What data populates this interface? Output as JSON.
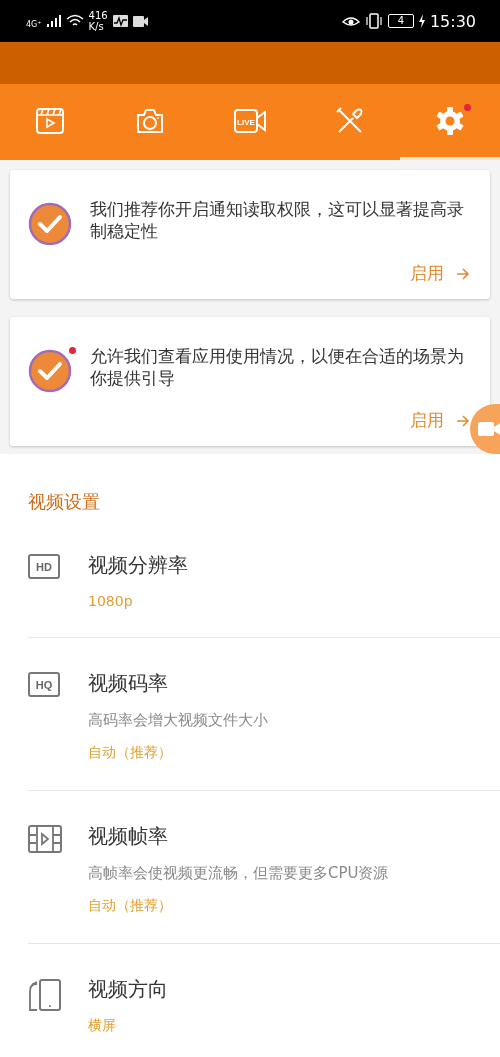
{
  "status_bar": {
    "network": "4G⁺",
    "speed_value": "416",
    "speed_unit": "K/s",
    "battery": "4",
    "time": "15:30"
  },
  "tabs": [
    {
      "kind": "clapper",
      "selected": false,
      "dot": false
    },
    {
      "kind": "camera",
      "selected": false,
      "dot": false
    },
    {
      "kind": "live",
      "icon_text": "LIVE",
      "selected": false,
      "dot": false
    },
    {
      "kind": "tools",
      "selected": false,
      "dot": false
    },
    {
      "kind": "settings",
      "selected": true,
      "dot": true
    }
  ],
  "cards": [
    {
      "text": "我们推荐你开启通知读取权限，这可以显著提高录制稳定性",
      "action": "启用",
      "dot": false
    },
    {
      "text": "允许我们查看应用使用情况，以便在合适的场景为你提供引导",
      "action": "启用",
      "dot": true
    }
  ],
  "section_title": "视频设置",
  "settings": [
    {
      "kind": "badge",
      "icon_text": "HD",
      "title": "视频分辨率",
      "value": "1080p"
    },
    {
      "kind": "badge",
      "icon_text": "HQ",
      "title": "视频码率",
      "description": "高码率会增大视频文件大小",
      "value": "自动（推荐）"
    },
    {
      "kind": "film",
      "title": "视频帧率",
      "description": "高帧率会使视频更流畅，但需要更多CPU资源",
      "value": "自动（推荐）"
    },
    {
      "kind": "phone",
      "title": "视频方向",
      "value": "横屏"
    }
  ]
}
